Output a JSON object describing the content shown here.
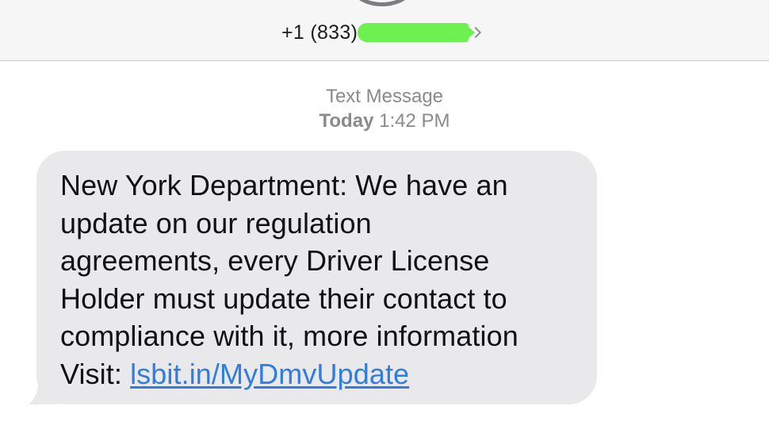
{
  "header": {
    "contact_number": "+1 (833)"
  },
  "conversation": {
    "message_type": "Text Message",
    "timestamp_day": "Today",
    "timestamp_time": "1:42 PM"
  },
  "message": {
    "lines": [
      "New York Department: We have an",
      "update on our regulation",
      "agreements, every Driver License",
      "Holder must update their contact to",
      "compliance with it, more information"
    ],
    "link_prefix": "Visit: ",
    "link_text": "lsbit.in/MyDmvUpdate"
  },
  "colors": {
    "bubble_background": "#e9e9eb",
    "link": "#2f7de1",
    "redaction": "#6cf150",
    "header_background": "#f6f6f6"
  },
  "icons": [
    "contact-avatar-icon",
    "chevron-right-icon"
  ]
}
